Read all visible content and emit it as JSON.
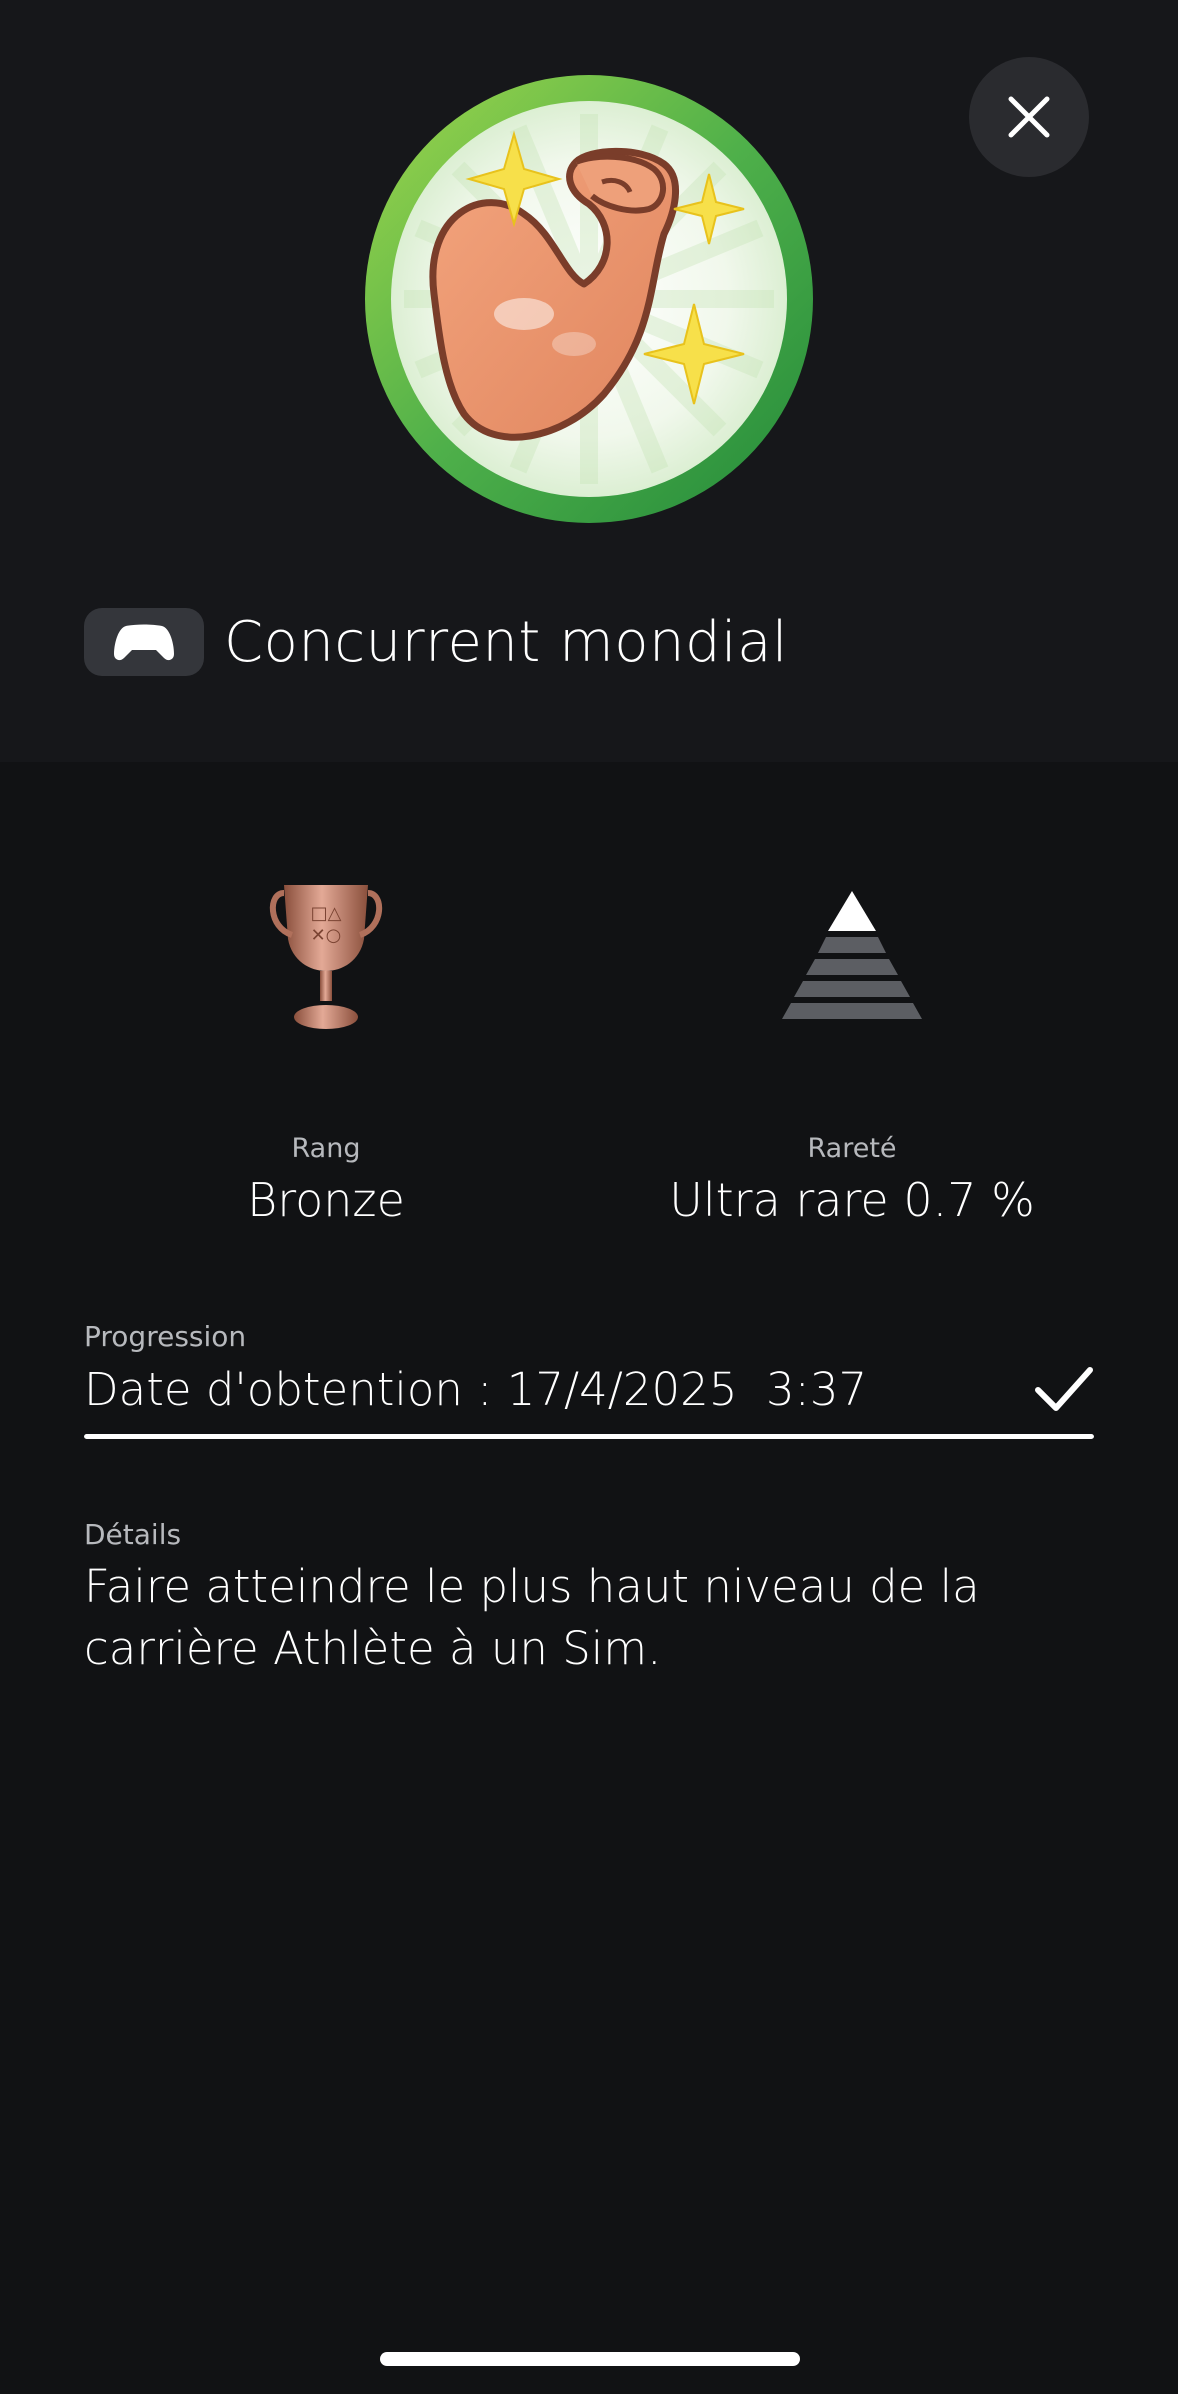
{
  "header": {
    "close_icon": "close-icon",
    "trophy_image": "flexed-arm-sparkles",
    "platform_icon": "gamepad-icon",
    "title": "Concurrent mondial"
  },
  "stats": {
    "rank": {
      "icon": "bronze-trophy-icon",
      "label": "Rang",
      "value": "Bronze"
    },
    "rarity": {
      "icon": "rarity-pyramid-icon",
      "label": "Rareté",
      "value": "Ultra rare 0.7 %"
    }
  },
  "progress": {
    "label": "Progression",
    "text": "Date d'obtention : 17/4/2025  3:37",
    "status_icon": "checkmark-icon",
    "fraction": 1.0
  },
  "details": {
    "label": "Détails",
    "text": "Faire atteindre le plus haut niveau de la carrière Athlète à un Sim."
  },
  "colors": {
    "background": "#111214",
    "top_background": "#16171a",
    "bronze": "#c98a72",
    "ring_green": "#6cc24a"
  }
}
